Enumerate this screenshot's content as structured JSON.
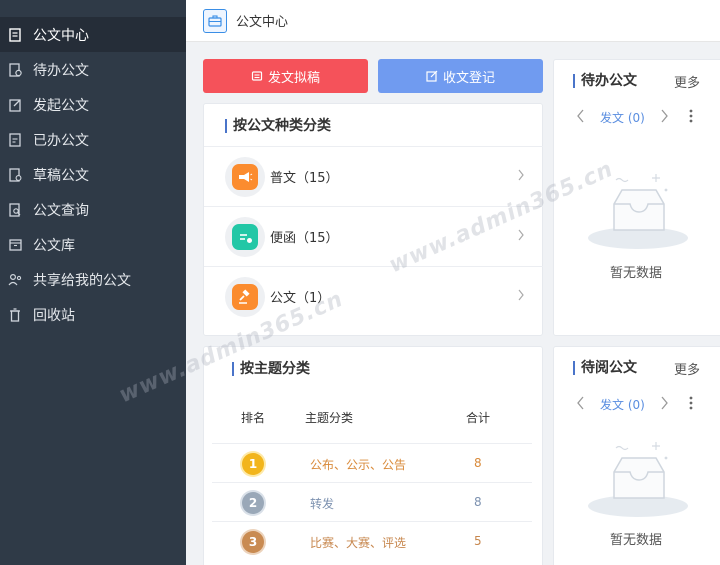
{
  "sidebar": {
    "items": [
      {
        "label": "公文中心",
        "icon": "document-icon"
      },
      {
        "label": "待办公文",
        "icon": "pending-doc-icon"
      },
      {
        "label": "发起公文",
        "icon": "edit-doc-icon"
      },
      {
        "label": "已办公文",
        "icon": "done-doc-icon"
      },
      {
        "label": "草稿公文",
        "icon": "draft-doc-icon"
      },
      {
        "label": "公文查询",
        "icon": "search-doc-icon"
      },
      {
        "label": "公文库",
        "icon": "archive-icon"
      },
      {
        "label": "共享给我的公文",
        "icon": "share-icon"
      },
      {
        "label": "回收站",
        "icon": "trash-icon"
      }
    ]
  },
  "header": {
    "title": "公文中心"
  },
  "actions": {
    "draft_label": "发文拟稿",
    "register_label": "收文登记"
  },
  "category": {
    "title": "按公文种类分类",
    "items": [
      {
        "label": "普文（15）",
        "color": "#fb8c2f"
      },
      {
        "label": "便函（15）",
        "color": "#22c7a6"
      },
      {
        "label": "公文（1）",
        "color": "#fb8c2f"
      }
    ]
  },
  "topic": {
    "title": "按主题分类",
    "headers": {
      "rank": "排名",
      "name": "主题分类",
      "total": "合计"
    },
    "rows": [
      {
        "rank": "1",
        "name": "公布、公示、公告",
        "count": "8",
        "badge": "#f2b51c",
        "color": "#d98a3a"
      },
      {
        "rank": "2",
        "name": "转发",
        "count": "8",
        "badge": "#9aa8b8",
        "color": "#7d92b0"
      },
      {
        "rank": "3",
        "name": "比赛、大赛、评选",
        "count": "5",
        "badge": "#c98b52",
        "color": "#c7874e"
      }
    ]
  },
  "pending": {
    "title": "待办公文",
    "more": "更多",
    "filter": "发文 (0)",
    "empty": "暂无数据"
  },
  "toread": {
    "title": "待阅公文",
    "more": "更多",
    "filter": "发文 (0)",
    "empty": "暂无数据"
  },
  "watermark": {
    "text": "www.admin365.cn"
  },
  "colors": {
    "sidebar_bg": "#2f3a47",
    "accent_blue": "#709bf0",
    "accent_red": "#f5525a"
  }
}
